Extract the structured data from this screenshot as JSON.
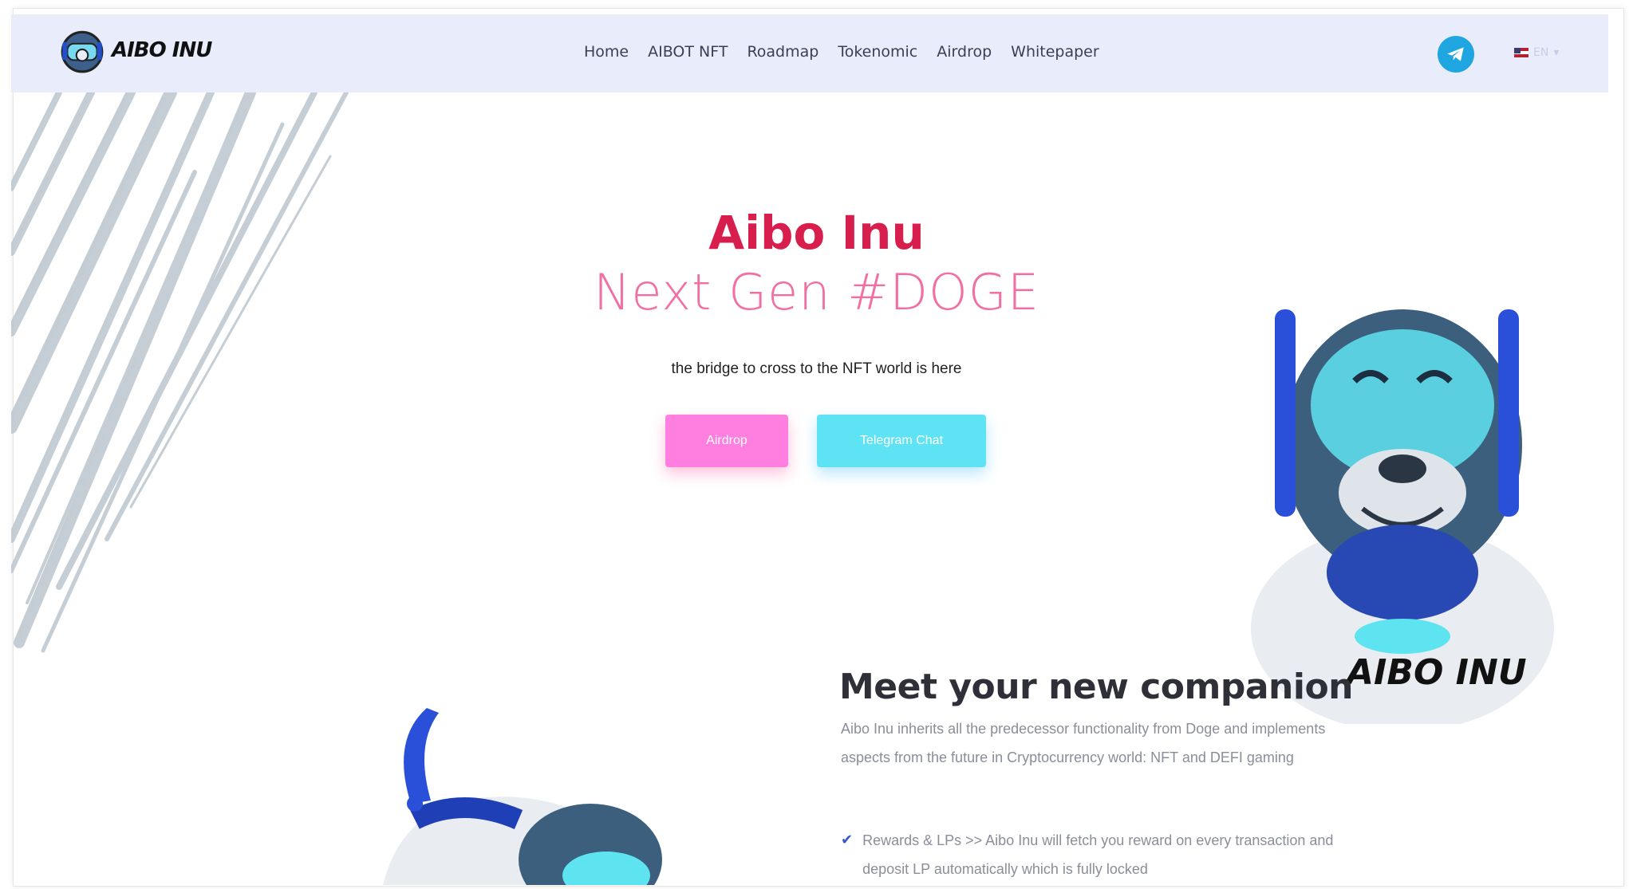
{
  "brand": {
    "logo_text": "AIBO INU"
  },
  "nav": {
    "items": [
      "Home",
      "AIBOT NFT",
      "Roadmap",
      "Tokenomic",
      "Airdrop",
      "Whitepaper"
    ]
  },
  "header": {
    "language_label": "EN"
  },
  "hero": {
    "title": "Aibo Inu",
    "subtitle": "Next Gen #DOGE",
    "tagline": "the bridge to cross to the NFT world is here",
    "airdrop_button": "Airdrop",
    "telegram_button": "Telegram Chat"
  },
  "robot": {
    "badge_text": "AIBO INU"
  },
  "meet": {
    "title": "Meet your new companion",
    "description": "Aibo Inu inherits all the predecessor functionality from Doge and implements aspects from the future in Cryptocurrency world: NFT and DEFI gaming",
    "feature_1": "Rewards & LPs >> Aibo Inu will fetch you reward on every transaction and deposit LP automatically which is fully locked"
  },
  "colors": {
    "accent_red": "#d81e4d",
    "accent_pink": "#f26fa4",
    "airdrop_btn": "#ff7fe0",
    "telegram_btn": "#5ee3f5",
    "navbar_bg": "#e9edfb",
    "telegram_icon": "#1fa6e0"
  },
  "icons": [
    "telegram-icon",
    "us-flag-icon",
    "chevron-down-icon",
    "check-icon",
    "robot-dog-logo-icon"
  ]
}
